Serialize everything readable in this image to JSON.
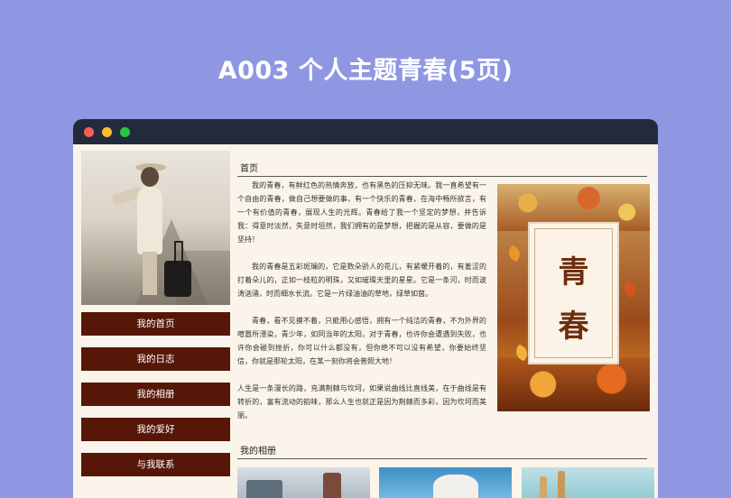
{
  "headline": "A003 个人主题青春(5页)",
  "sidebar": {
    "nav": [
      {
        "label": "我的首页"
      },
      {
        "label": "我的日志"
      },
      {
        "label": "我的相册"
      },
      {
        "label": "我的爱好"
      },
      {
        "label": "与我联系"
      }
    ]
  },
  "main": {
    "section_title": "首页",
    "paragraphs": [
      "我的青春，有鲜红色的热情奔放，也有黑色的压抑无味。我一直希望有一个自由的青春，做自己想要做的事，有一个快乐的青春，在海中畅所欲言，有一个有价值的青春，展现人生的光辉。青春给了我一个坚定的梦想，并告诉我：得意时淡然，失意时坦然，我们拥有的是梦想，把握的是从容，要做的是坚持！",
      "我的青春是五彩斑斓的，它是数朵骄人的花儿，有紧暖开着的，有羞涩的打着朵儿的，正如一枝粒的明珠，又如璀璨天里的星星。它是一条河，时而波涛汹涌，时而细水长流。它是一片绿油油的草地，绿草如茵。",
      "青春，看不见摸不着，只能用心感悟，拥有一个纯洁的青春，不为外界的喧嚣所浸染，青少年，如同当年的太阳，对于青春，也许你会遭遇到失败，也许你会碰到挫折，你可以什么都没有，但你绝不可以没有希望，你要始终坚信，你就是那轮太阳，在某一刻你将会普照大地！",
      "人生是一条漫长的路，充满荆棘与坎坷，如果说曲线比直线美，在于曲线是有转折的，富有流动的韵味，那么人生也就正是因为荆棘而多彩，因为坎坷而美丽。"
    ],
    "poster": {
      "char1": "青",
      "char2": "春"
    },
    "album_title": "我的相册"
  }
}
